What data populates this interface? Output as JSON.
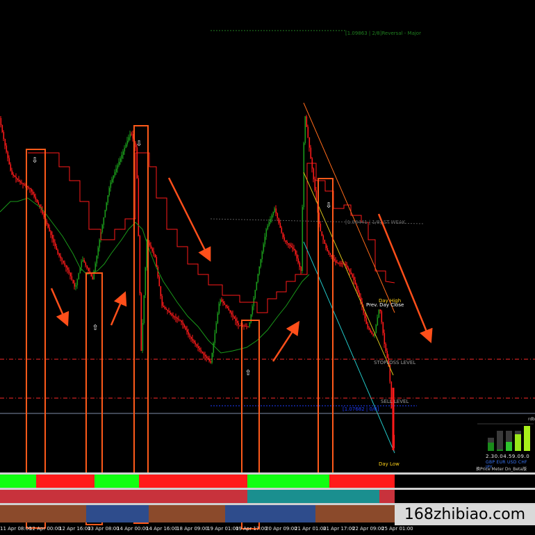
{
  "chart_data": {
    "type": "candlestick",
    "instrument_labels": {
      "reversal_major": "[1.09863 | 2/8]Reversal - Major",
      "weak": "[1.08441 | 1/8] ST WEAK",
      "stoploss": "STOPLOSS LEVEL",
      "sell": "SELL LEVEL",
      "day_high": "Day High",
      "prev_day_close": "Prev. Day Close",
      "day_low": "Day Low",
      "blue_level": "[1.07682 | 0/8]"
    },
    "x_ticks": [
      "11 Apr 08:00",
      "12 Apr 00:00",
      "12 Apr 16:00",
      "13 Apr 08:00",
      "14 Apr 00:00",
      "14 Apr 16:00",
      "18 Apr 09:00",
      "19 Apr 01:00",
      "19 Apr 17:00",
      "20 Apr 09:00",
      "21 Apr 01:00",
      "21 Apr 17:00",
      "22 Apr 09:00",
      "25 Apr 01:00"
    ],
    "price_meter": {
      "header": "rdb",
      "values": "2.30.04.59.09.0",
      "currencies": "GBP EUR USD CHF JPY",
      "caption": "换Price Meter Dn_Beta版"
    },
    "watermark": "168zhibiao.com",
    "colors": {
      "bull": "#1a9a1a",
      "bear": "#ff1a1a",
      "box": "#ff5a1a",
      "arrow": "#ff4f1a",
      "level": "#ff2a2a"
    }
  }
}
